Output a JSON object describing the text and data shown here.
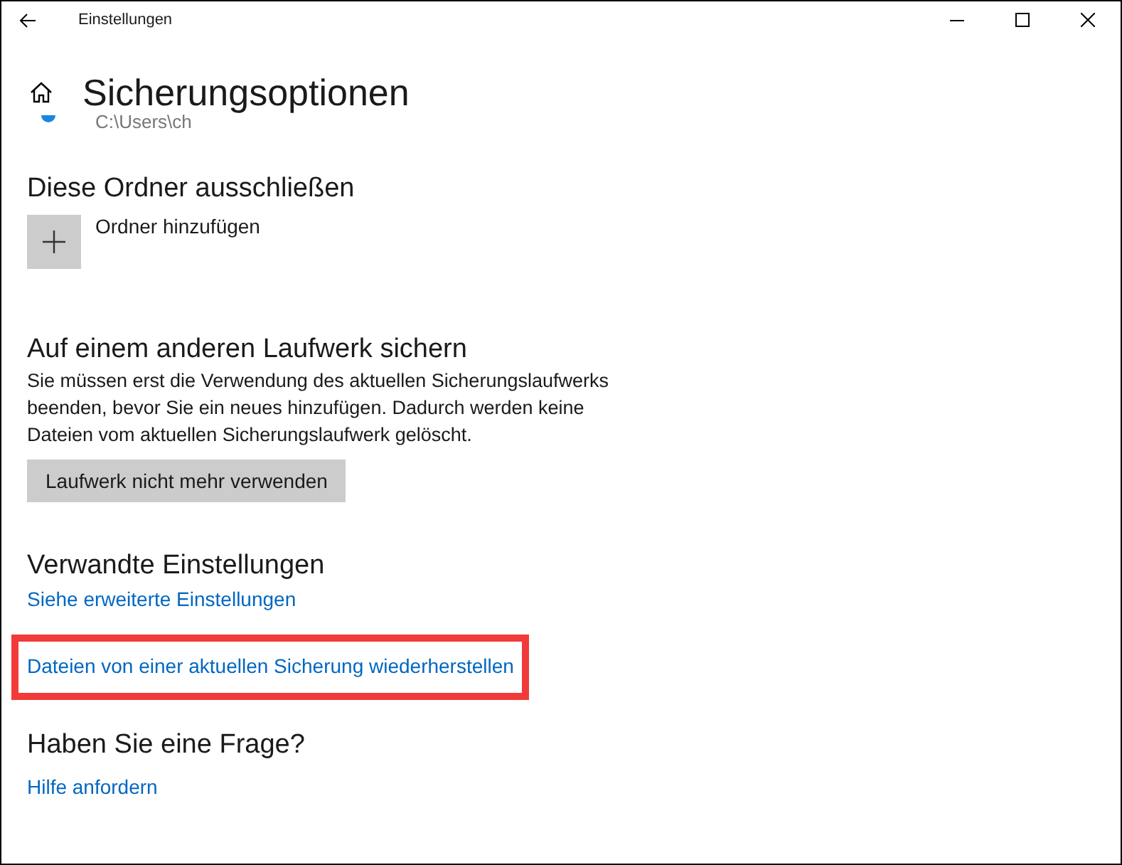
{
  "window": {
    "title": "Einstellungen"
  },
  "page": {
    "title": "Sicherungsoptionen",
    "partial_path": "C:\\Users\\ch"
  },
  "exclude": {
    "heading": "Diese Ordner ausschließen",
    "add_label": "Ordner hinzufügen"
  },
  "other_drive": {
    "heading": "Auf einem anderen Laufwerk sichern",
    "description": "Sie müssen erst die Verwendung des aktuellen Sicherungslaufwerks beenden, bevor Sie ein neues hinzufügen. Dadurch werden keine Dateien vom aktuellen Sicherungslaufwerk gelöscht.",
    "button": "Laufwerk nicht mehr verwenden"
  },
  "related": {
    "heading": "Verwandte Einstellungen",
    "links": [
      {
        "label": "Siehe erweiterte Einstellungen",
        "highlighted": false
      },
      {
        "label": "Dateien von einer aktuellen Sicherung wiederherstellen",
        "highlighted": true
      }
    ]
  },
  "help": {
    "heading": "Haben Sie eine Frage?",
    "link": "Hilfe anfordern"
  }
}
